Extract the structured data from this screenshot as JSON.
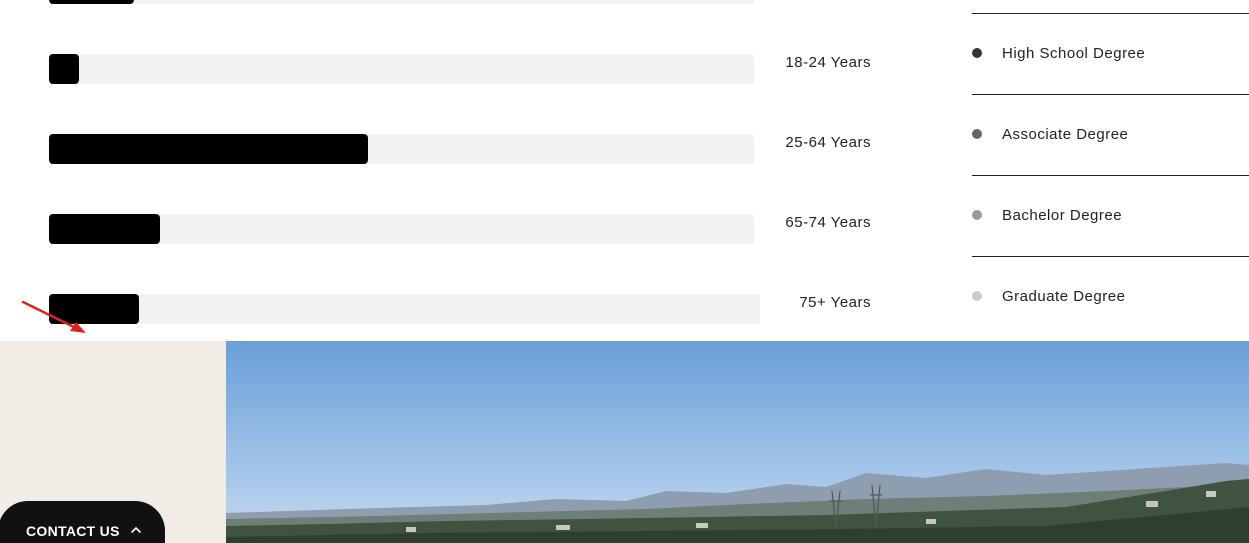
{
  "age_bars": [
    {
      "label": "",
      "fraction": 0.12
    },
    {
      "label": "18-24 Years",
      "fraction": 0.042
    },
    {
      "label": "25-64 Years",
      "fraction": 0.452
    },
    {
      "label": "65-74 Years",
      "fraction": 0.157
    },
    {
      "label": "75+ Years",
      "fraction": 0.126
    }
  ],
  "education_legend": [
    {
      "label": "High School Degree",
      "color": "#333333"
    },
    {
      "label": "Associate Degree",
      "color": "#666666"
    },
    {
      "label": "Bachelor Degree",
      "color": "#999999"
    },
    {
      "label": "Graduate Degree",
      "color": "#cccccc"
    }
  ],
  "contact": {
    "label": "CONTACT US",
    "icon": "chevron-up-icon"
  },
  "annotation": {
    "icon": "red-arrow-icon",
    "color": "#e02020"
  },
  "photo": {
    "description_icon": "landscape-photo",
    "sky_color": "#6a9fd8"
  }
}
